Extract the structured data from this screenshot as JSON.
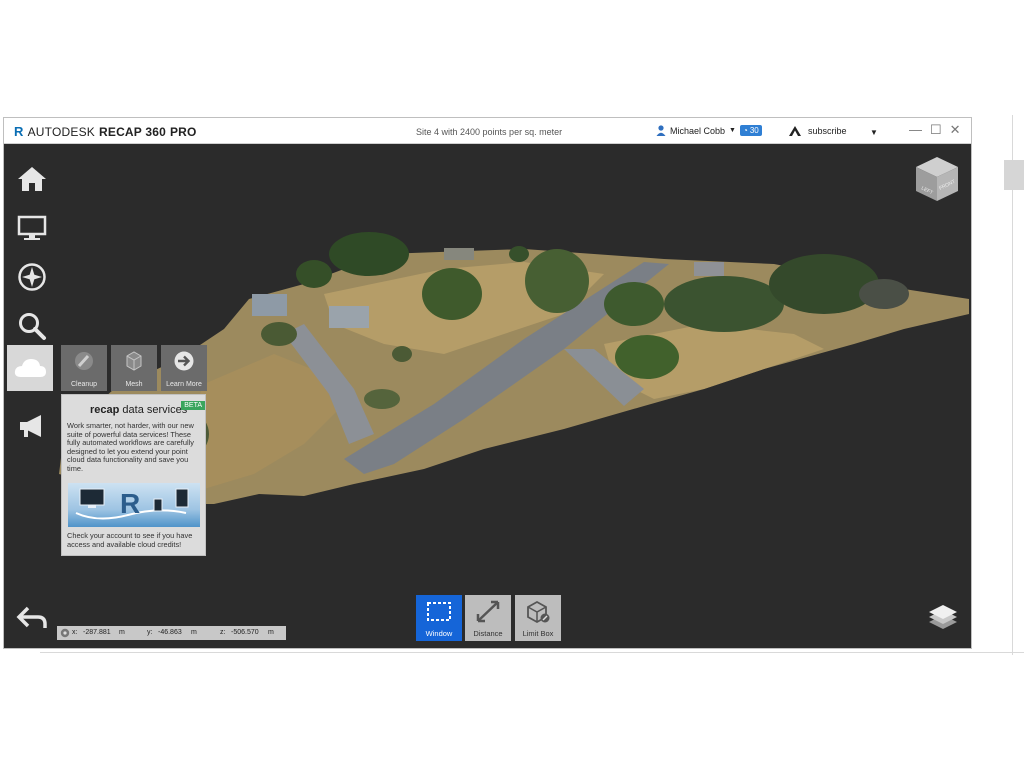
{
  "app": {
    "brand": "AUTODESK",
    "product": "RECAP 360",
    "edition": "PRO",
    "document_title": "Site 4 with 2400 points per sq. meter"
  },
  "user": {
    "name": "Michael Cobb",
    "credits": "30"
  },
  "subscribe": {
    "label": "subscribe"
  },
  "window_controls": {
    "minimize": "—",
    "maximize": "☐",
    "close": "✕"
  },
  "left_toolbar": {
    "items": [
      {
        "name": "home",
        "icon": "home-icon"
      },
      {
        "name": "display",
        "icon": "monitor-icon"
      },
      {
        "name": "navigation",
        "icon": "compass-icon"
      },
      {
        "name": "search",
        "icon": "search-icon"
      },
      {
        "name": "cloud-services",
        "icon": "cloud-icon"
      },
      {
        "name": "announce",
        "icon": "megaphone-icon"
      }
    ]
  },
  "data_services": {
    "tiles": [
      {
        "label": "Cleanup",
        "icon": "brush-icon"
      },
      {
        "label": "Mesh",
        "icon": "mesh-icon"
      },
      {
        "label": "Learn More",
        "icon": "arrow-right-circle-icon"
      }
    ],
    "title_bold": "recap",
    "title_rest": " data services",
    "badge": "BETA",
    "body": "Work smarter, not harder, with our new suite of powerful data services! These fully automated workflows are carefully designed to let you extend your point cloud data functionality and save you time.",
    "footer": "Check your account to see if you have access and available cloud credits!"
  },
  "coords": {
    "x_label": "x:",
    "x_value": "-287.881",
    "x_unit": "m",
    "y_label": "y:",
    "y_value": "-46.863",
    "y_unit": "m",
    "z_label": "z:",
    "z_value": "-506.570",
    "z_unit": "m"
  },
  "selection_tools": [
    {
      "label": "Window",
      "active": true
    },
    {
      "label": "Distance",
      "active": false
    },
    {
      "label": "Limit Box",
      "active": false
    }
  ],
  "viewcube": {
    "left_face": "LEFT",
    "right_face": "FRONT"
  },
  "colors": {
    "viewport_bg": "#2b2b2b",
    "accent_blue": "#1565d8",
    "beta_green": "#3aa55d"
  }
}
